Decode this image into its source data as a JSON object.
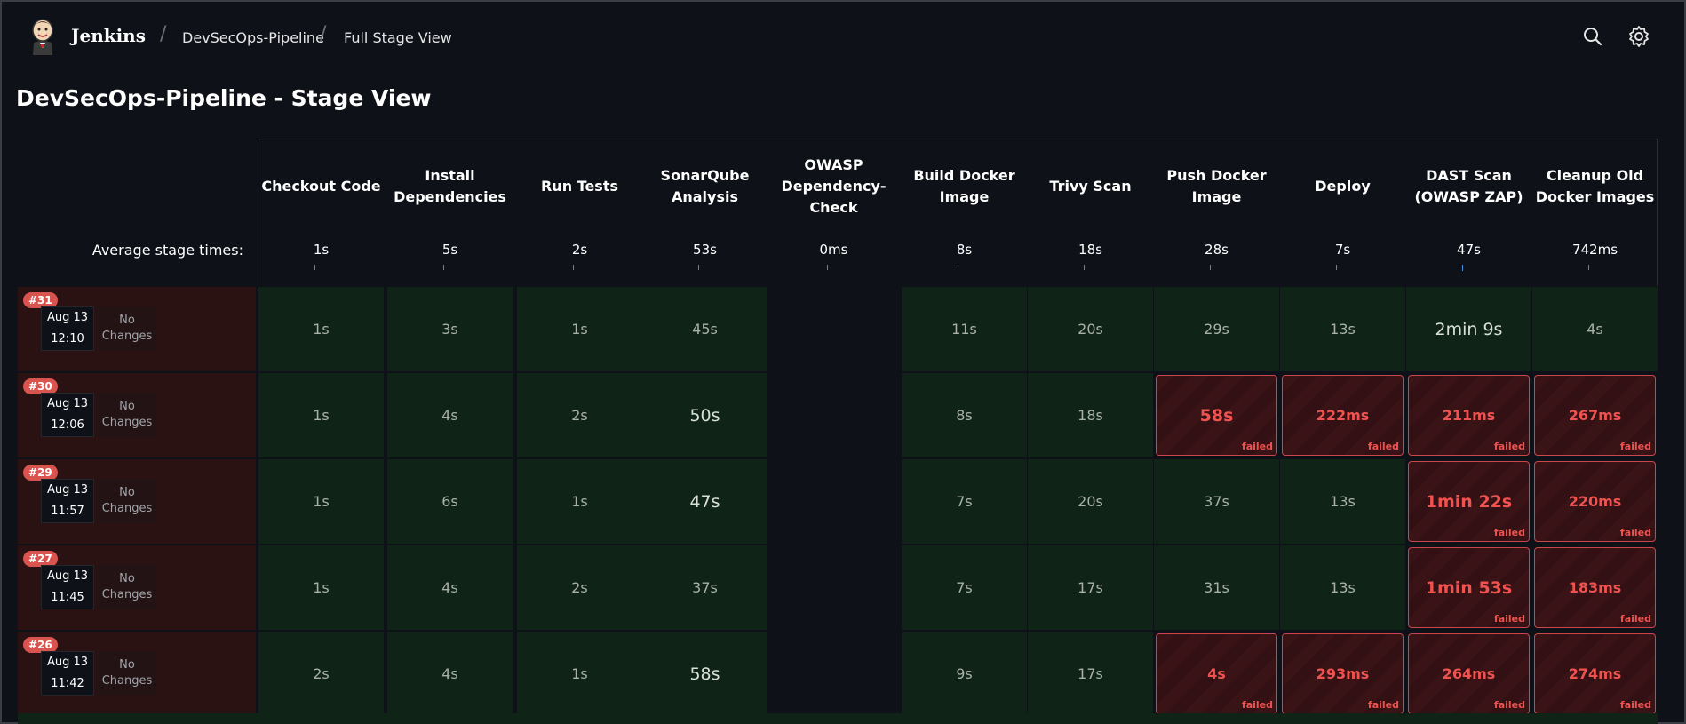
{
  "header": {
    "brand": "Jenkins",
    "breadcrumbs": [
      "DevSecOps-Pipeline",
      "Full Stage View"
    ],
    "search_icon": "search-icon",
    "settings_icon": "gear-icon"
  },
  "page": {
    "title": "DevSecOps-Pipeline - Stage View",
    "avg_label": "Average stage times:"
  },
  "colors": {
    "success_bg": "#0f2416",
    "failed_border": "#c8474b",
    "failed_text": "#ef5350",
    "badge": "#d9534f"
  },
  "stages": [
    {
      "name": "Checkout Code",
      "avg": "1s"
    },
    {
      "name": "Install Dependencies",
      "avg": "5s"
    },
    {
      "name": "Run Tests",
      "avg": "2s"
    },
    {
      "name": "SonarQube Analysis",
      "avg": "53s"
    },
    {
      "name": "OWASP Dependency-Check",
      "avg": "0ms"
    },
    {
      "name": "Build Docker Image",
      "avg": "8s"
    },
    {
      "name": "Trivy Scan",
      "avg": "18s"
    },
    {
      "name": "Push Docker Image",
      "avg": "28s"
    },
    {
      "name": "Deploy",
      "avg": "7s"
    },
    {
      "name": "DAST Scan (OWASP ZAP)",
      "avg": "47s"
    },
    {
      "name": "Cleanup Old Docker Images",
      "avg": "742ms"
    }
  ],
  "builds": [
    {
      "id": "#31",
      "date": "Aug 13",
      "time": "12:10",
      "changes": "No Changes",
      "cells": [
        {
          "value": "1s",
          "status": "ok"
        },
        {
          "value": "3s",
          "status": "ok"
        },
        {
          "value": "1s",
          "status": "ok"
        },
        {
          "value": "45s",
          "status": "ok"
        },
        {
          "value": "",
          "status": "none"
        },
        {
          "value": "11s",
          "status": "ok"
        },
        {
          "value": "20s",
          "status": "ok"
        },
        {
          "value": "29s",
          "status": "ok"
        },
        {
          "value": "13s",
          "status": "ok"
        },
        {
          "value": "2min 9s",
          "status": "ok",
          "big": true
        },
        {
          "value": "4s",
          "status": "ok"
        }
      ]
    },
    {
      "id": "#30",
      "date": "Aug 13",
      "time": "12:06",
      "changes": "No Changes",
      "cells": [
        {
          "value": "1s",
          "status": "ok"
        },
        {
          "value": "4s",
          "status": "ok"
        },
        {
          "value": "2s",
          "status": "ok"
        },
        {
          "value": "50s",
          "status": "ok",
          "big": true
        },
        {
          "value": "",
          "status": "none"
        },
        {
          "value": "8s",
          "status": "ok"
        },
        {
          "value": "18s",
          "status": "ok"
        },
        {
          "value": "58s",
          "status": "fail",
          "big": true
        },
        {
          "value": "222ms",
          "status": "fail"
        },
        {
          "value": "211ms",
          "status": "fail"
        },
        {
          "value": "267ms",
          "status": "fail"
        }
      ]
    },
    {
      "id": "#29",
      "date": "Aug 13",
      "time": "11:57",
      "changes": "No Changes",
      "cells": [
        {
          "value": "1s",
          "status": "ok"
        },
        {
          "value": "6s",
          "status": "ok"
        },
        {
          "value": "1s",
          "status": "ok"
        },
        {
          "value": "47s",
          "status": "ok",
          "big": true
        },
        {
          "value": "",
          "status": "none"
        },
        {
          "value": "7s",
          "status": "ok"
        },
        {
          "value": "20s",
          "status": "ok"
        },
        {
          "value": "37s",
          "status": "ok"
        },
        {
          "value": "13s",
          "status": "ok"
        },
        {
          "value": "1min 22s",
          "status": "fail",
          "big": true
        },
        {
          "value": "220ms",
          "status": "fail"
        }
      ]
    },
    {
      "id": "#27",
      "date": "Aug 13",
      "time": "11:45",
      "changes": "No Changes",
      "cells": [
        {
          "value": "1s",
          "status": "ok"
        },
        {
          "value": "4s",
          "status": "ok"
        },
        {
          "value": "2s",
          "status": "ok"
        },
        {
          "value": "37s",
          "status": "ok"
        },
        {
          "value": "",
          "status": "none"
        },
        {
          "value": "7s",
          "status": "ok"
        },
        {
          "value": "17s",
          "status": "ok"
        },
        {
          "value": "31s",
          "status": "ok"
        },
        {
          "value": "13s",
          "status": "ok"
        },
        {
          "value": "1min 53s",
          "status": "fail",
          "big": true
        },
        {
          "value": "183ms",
          "status": "fail"
        }
      ]
    },
    {
      "id": "#26",
      "date": "Aug 13",
      "time": "11:42",
      "changes": "No Changes",
      "cells": [
        {
          "value": "2s",
          "status": "ok"
        },
        {
          "value": "4s",
          "status": "ok"
        },
        {
          "value": "1s",
          "status": "ok"
        },
        {
          "value": "58s",
          "status": "ok",
          "big": true
        },
        {
          "value": "",
          "status": "none"
        },
        {
          "value": "9s",
          "status": "ok"
        },
        {
          "value": "17s",
          "status": "ok"
        },
        {
          "value": "4s",
          "status": "fail"
        },
        {
          "value": "293ms",
          "status": "fail"
        },
        {
          "value": "264ms",
          "status": "fail"
        },
        {
          "value": "274ms",
          "status": "fail"
        }
      ]
    }
  ],
  "failed_label": "failed"
}
